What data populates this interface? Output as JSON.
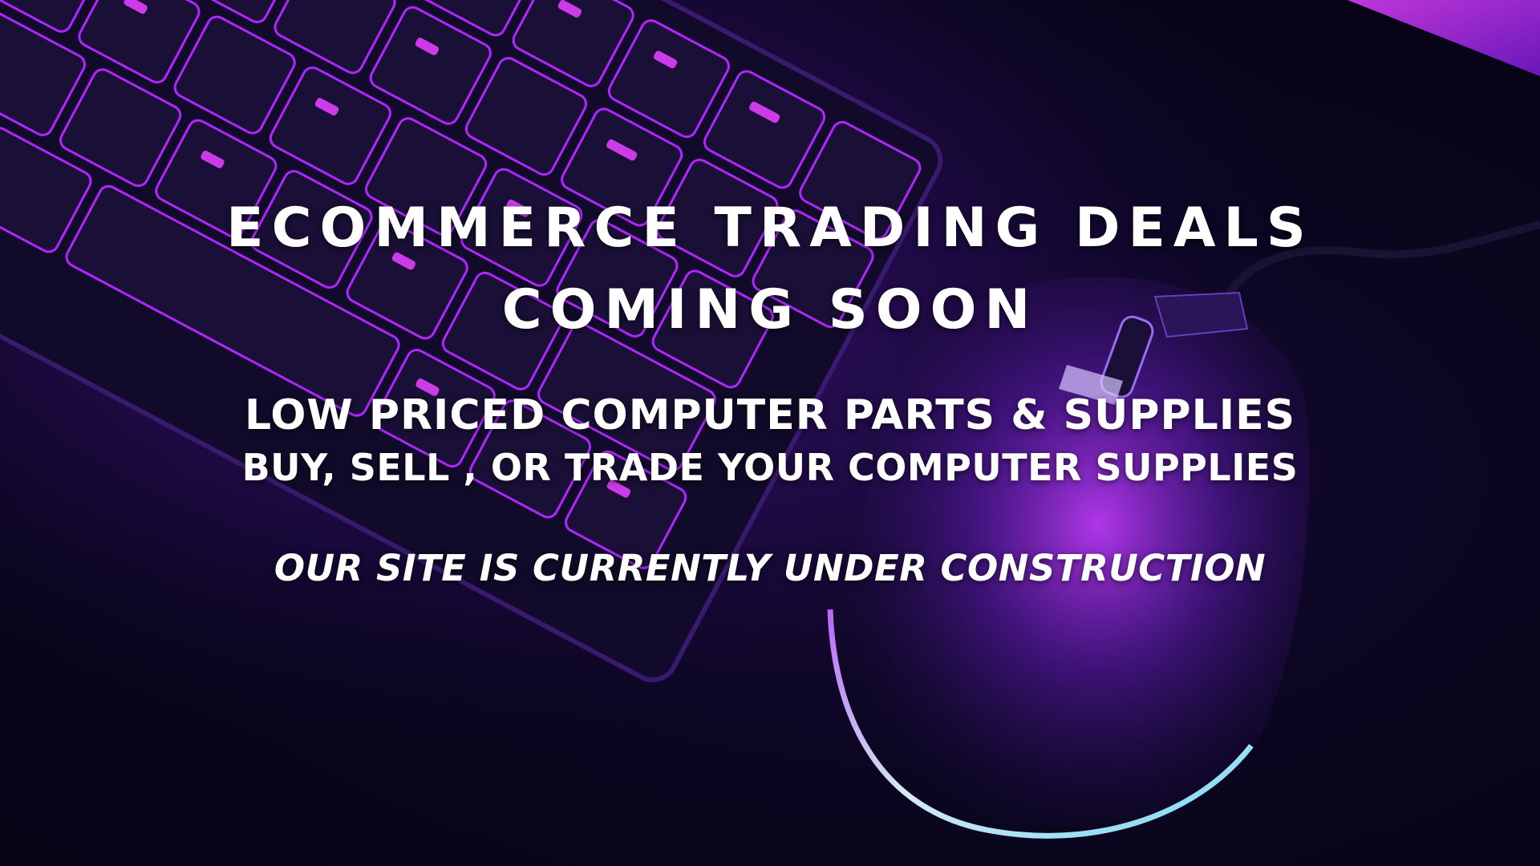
{
  "page": {
    "headline_line1": "ECOMMERCE TRADING DEALS",
    "headline_line2": "COMING SOON",
    "subheading_line1": "LOW PRICED COMPUTER PARTS & SUPPLIES",
    "subheading_line2": "BUY, SELL , OR TRADE YOUR COMPUTER SUPPLIES",
    "notice": "OUR SITE IS CURRENTLY UNDER CONSTRUCTION"
  },
  "background": {
    "subject": "backlit gaming keyboard and mouse",
    "colors": {
      "base": "#07051a",
      "glow_purple": "#b026ff",
      "glow_magenta": "#e040fb",
      "mouse_rim": "#a0e8ff"
    }
  }
}
